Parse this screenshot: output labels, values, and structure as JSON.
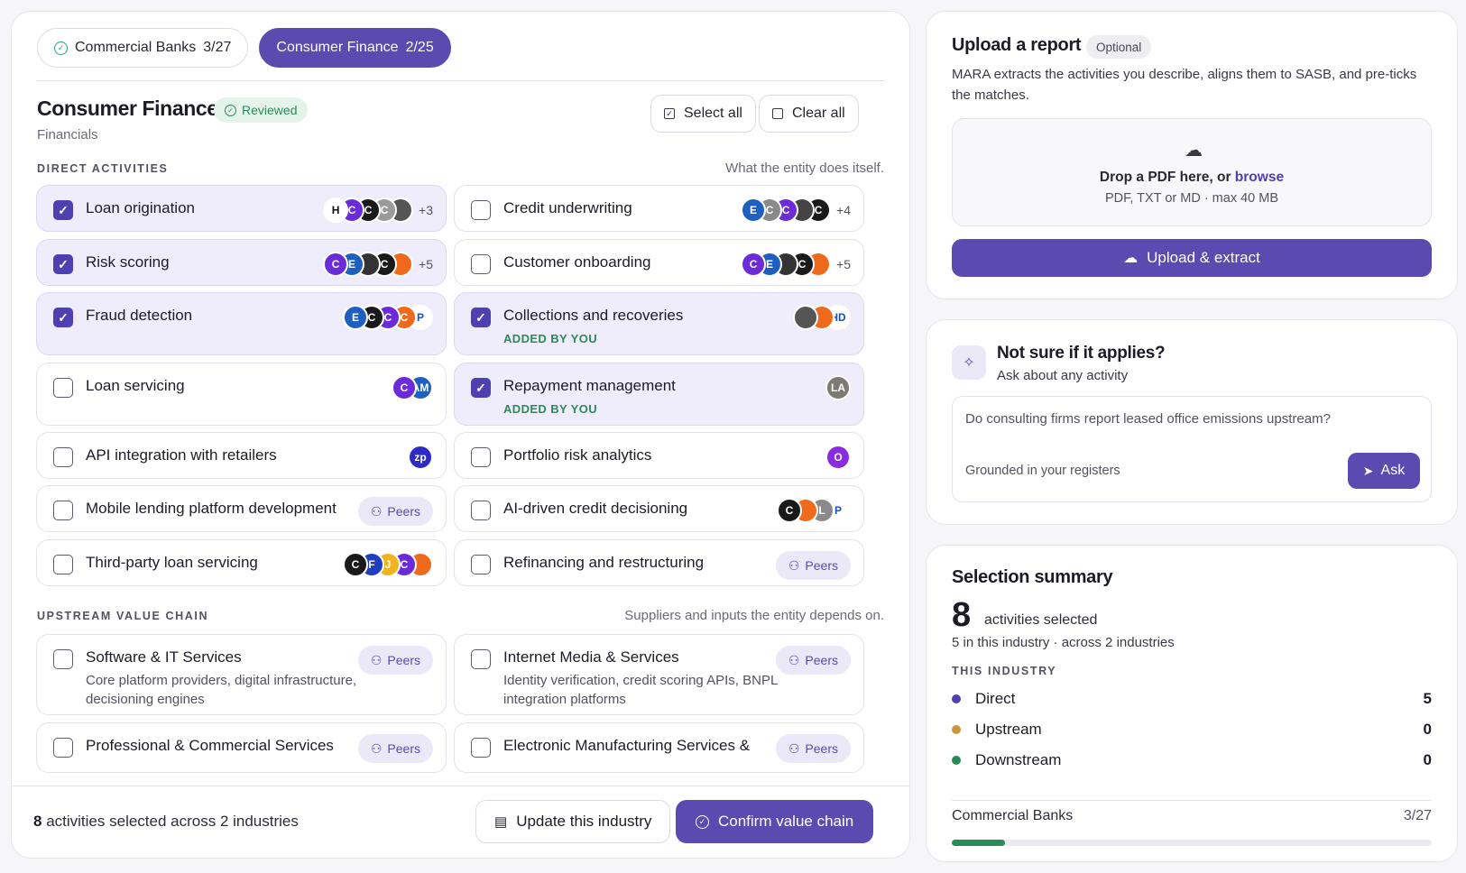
{
  "tabs": [
    {
      "label": "Commercial Banks",
      "count": "3/27",
      "done": true,
      "active": false
    },
    {
      "label": "Consumer Finance",
      "count": "2/25",
      "done": false,
      "active": true
    }
  ],
  "industry": {
    "title": "Consumer Finance",
    "badge": "Reviewed",
    "sector": "Financials"
  },
  "actions": {
    "select_all": "Select all",
    "clear_all": "Clear all"
  },
  "direct": {
    "heading": "DIRECT ACTIVITIES",
    "note": "What the entity does itself.",
    "items": [
      {
        "label": "Loan origination",
        "selected": true,
        "logos": [
          {
            "t": "H",
            "c": "#ffffff",
            "fg": "#111111"
          },
          {
            "t": "C",
            "c": "#6b2bd9"
          },
          {
            "t": "C",
            "c": "#1a1a1a"
          },
          {
            "t": "C",
            "c": "#9a9a9a"
          },
          {
            "t": "",
            "c": "#555555"
          }
        ],
        "more": "+3"
      },
      {
        "label": "Credit underwriting",
        "selected": false,
        "logos": [
          {
            "t": "E",
            "c": "#1f5fbf"
          },
          {
            "t": "C",
            "c": "#8a8a8a"
          },
          {
            "t": "C",
            "c": "#6b2bd9"
          },
          {
            "t": "",
            "c": "#444444"
          },
          {
            "t": "C",
            "c": "#1a1a1a"
          }
        ],
        "more": "+4"
      },
      {
        "label": "Risk scoring",
        "selected": true,
        "logos": [
          {
            "t": "C",
            "c": "#6b2bd9"
          },
          {
            "t": "E",
            "c": "#1f5fbf"
          },
          {
            "t": "",
            "c": "#333333"
          },
          {
            "t": "C",
            "c": "#1a1a1a"
          },
          {
            "t": "",
            "c": "#f06a1d"
          }
        ],
        "more": "+5"
      },
      {
        "label": "Customer onboarding",
        "selected": false,
        "logos": [
          {
            "t": "C",
            "c": "#6b2bd9"
          },
          {
            "t": "E",
            "c": "#1f5fbf"
          },
          {
            "t": "",
            "c": "#333333"
          },
          {
            "t": "C",
            "c": "#1a1a1a"
          },
          {
            "t": "",
            "c": "#f06a1d"
          }
        ],
        "more": "+5"
      },
      {
        "label": "Fraud detection",
        "selected": true,
        "logos": [
          {
            "t": "E",
            "c": "#1f5fbf"
          },
          {
            "t": "C",
            "c": "#1a1a1a"
          },
          {
            "t": "C",
            "c": "#6b2bd9"
          },
          {
            "t": "C",
            "c": "#f06a1d"
          },
          {
            "t": "P",
            "c": "#ffffff",
            "fg": "#1d4fbf"
          }
        ],
        "more": ""
      },
      {
        "label": "Collections and recoveries",
        "selected": true,
        "added": "ADDED BY YOU",
        "logos": [
          {
            "t": "",
            "c": "#555555"
          },
          {
            "t": "",
            "c": "#f06a1d"
          },
          {
            "t": "HD",
            "c": "#ffffff",
            "fg": "#1d4fbf"
          }
        ],
        "more": ""
      },
      {
        "label": "Loan servicing",
        "selected": false,
        "logos": [
          {
            "t": "C",
            "c": "#6b2bd9"
          },
          {
            "t": "AM",
            "c": "#1f5fbf"
          }
        ],
        "more": ""
      },
      {
        "label": "Repayment management",
        "selected": true,
        "added": "ADDED BY YOU",
        "logos": [
          {
            "t": "LA",
            "c": "#7d7a74"
          }
        ],
        "more": ""
      },
      {
        "label": "API integration with retailers",
        "selected": false,
        "logos": [
          {
            "t": "zp",
            "c": "#2e2bc4"
          }
        ],
        "more": ""
      },
      {
        "label": "Portfolio risk analytics",
        "selected": false,
        "logos": [
          {
            "t": "O",
            "c": "#8a2be2"
          }
        ],
        "more": ""
      },
      {
        "label": "Mobile lending platform development",
        "selected": false,
        "peers": "Peers"
      },
      {
        "label": "AI-driven credit decisioning",
        "selected": false,
        "logos": [
          {
            "t": "C",
            "c": "#1a1a1a"
          },
          {
            "t": "",
            "c": "#f06a1d"
          },
          {
            "t": "L",
            "c": "#8a8a8a"
          },
          {
            "t": "P",
            "c": "#ffffff",
            "fg": "#1d4fbf"
          }
        ],
        "more": ""
      },
      {
        "label": "Third-party loan servicing",
        "selected": false,
        "logos": [
          {
            "t": "C",
            "c": "#1a1a1a"
          },
          {
            "t": "F",
            "c": "#1f3fbf"
          },
          {
            "t": "J",
            "c": "#f0b41d"
          },
          {
            "t": "C",
            "c": "#6b2bd9"
          },
          {
            "t": "",
            "c": "#f06a1d"
          }
        ],
        "more": ""
      },
      {
        "label": "Refinancing and restructuring",
        "selected": false,
        "peers": "Peers"
      }
    ]
  },
  "upstream": {
    "heading": "UPSTREAM VALUE CHAIN",
    "note": "Suppliers and inputs the entity depends on.",
    "items": [
      {
        "label": "Software & IT Services",
        "desc": "Core platform providers, digital infrastructure, decisioning engines",
        "peers": "Peers"
      },
      {
        "label": "Internet Media & Services",
        "desc": "Identity verification, credit scoring APIs, BNPL integration platforms",
        "peers": "Peers"
      },
      {
        "label": "Professional & Commercial Services",
        "desc": "",
        "peers": "Peers"
      },
      {
        "label": "Electronic Manufacturing Services &",
        "desc": "",
        "peers": "Peers"
      }
    ]
  },
  "footer": {
    "count": "8",
    "text": "activities selected across 2 industries",
    "update": "Update this industry",
    "confirm": "Confirm value chain"
  },
  "upload": {
    "title": "Upload a report",
    "optional": "Optional",
    "desc": "MARA extracts the activities you describe, aligns them to SASB, and pre-ticks the matches.",
    "drop_text": "Drop a PDF here, or ",
    "browse": "browse",
    "formats": "PDF, TXT or MD · max 40 MB",
    "button": "Upload & extract"
  },
  "ask": {
    "title": "Not sure if it applies?",
    "subtitle": "Ask about any activity",
    "placeholder": "Do consulting firms report leased office emissions upstream?",
    "grounded": "Grounded in your registers",
    "button": "Ask"
  },
  "summary": {
    "title": "Selection summary",
    "count": "8",
    "count_label": "activities selected",
    "detail": "5 in this industry · across 2 industries",
    "section": "THIS INDUSTRY",
    "rows": [
      {
        "label": "Direct",
        "value": "5",
        "color": "#4f3fb0"
      },
      {
        "label": "Upstream",
        "value": "0",
        "color": "#c99540"
      },
      {
        "label": "Downstream",
        "value": "0",
        "color": "#2a8a58"
      }
    ],
    "progress": {
      "label": "Commercial Banks",
      "value": "3/27",
      "fraction": 0.111
    }
  },
  "colors": {
    "accent": "#5b4ab0",
    "success": "#2a8a58"
  }
}
